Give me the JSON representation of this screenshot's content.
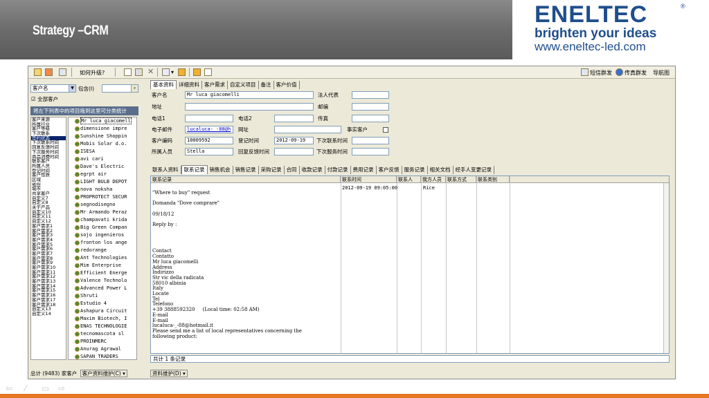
{
  "slide": {
    "title": "Strategy –CRM",
    "logo": {
      "name": "ENELTEC",
      "reg": "®",
      "tagline": "brighten your ideas",
      "url": "www.eneltec-led.com"
    }
  },
  "toolbar": {
    "upgrade_label": "如何升级?",
    "sms_label": "短信群发",
    "fax_label": "传真群发",
    "nav_label": "导航图"
  },
  "left": {
    "combo_value": "客户名",
    "include_label": "包含(I)",
    "search_value": "",
    "all_customers_label": "全部客户",
    "category_header": "将左下列表中的项目拖到这里可分类统计",
    "fields": [
      "客户来源",
      "所属行业",
      "客户等级",
      "下次联系",
      "签约状态",
      "下次联系时间",
      "回复反馈时间",
      "下次服务时间",
      "商品消费时间",
      "联系客户",
      "所属人员",
      "登记时间",
      "客户性质",
      "区域",
      "省份",
      "城市",
      "共享客户",
      "自定义7",
      "自定义8",
      "关于产品",
      "自定义10",
      "自定义11",
      "自定义12",
      "客户需求1",
      "客户需求2",
      "客户需求3",
      "客户需求4",
      "客户需求5",
      "客户需求6",
      "客户需求7",
      "客户需求8",
      "客户需求9",
      "客户需求10",
      "客户需求11",
      "客户需求12",
      "客户需求13",
      "客户需求14",
      "客户需求15",
      "客户需求16",
      "客户需求17",
      "客户需求18",
      "自定义13",
      "自定义14"
    ],
    "selected_field_index": 4,
    "customers": [
      "Mr luca giacomell",
      "dimensione impre",
      "Sunshine Shoppin",
      "Mobis Solar d.o.",
      "ISESA",
      "avi cari",
      "Dave's Electric",
      "egrpt air",
      "LIGHT BULB DEPOT",
      "nova noksha",
      "PROPROTECT SECUR",
      "segnodisegno",
      "Mr Armando Peraz",
      "champavati krida",
      "Big Green Compan",
      "sojo ingenieros",
      "fronton los ange",
      "redorange",
      "Ant Technologies",
      "Mim Enterprise",
      "Efficient Energe",
      "Valence Technolo",
      "Advanced Power L",
      "Shruti",
      "Estudio 4",
      "Ashapura Circuit",
      "Maxim Biotech, I",
      "ENAS TECHNOLOGIE",
      "tecnomascota sl",
      "PROINMERC",
      "Anurag Agrawal",
      "SAPAN TRADERS"
    ],
    "status_total": "总计 (9483) 家客户",
    "maintain_label": "客户资料维护(C)"
  },
  "right": {
    "top_tabs": [
      "基本资料",
      "详细资料",
      "客户需求",
      "自定义项目",
      "备注",
      "客户价值"
    ],
    "fields": {
      "customer_name_label": "客户名",
      "customer_name": "Mr luca giacomelli",
      "legal_rep_label": "法人代表",
      "legal_rep": "",
      "address_label": "地址",
      "address": "",
      "postcode_label": "邮编",
      "postcode": "",
      "phone1_label": "电话1",
      "phone1": "",
      "phone2_label": "电话2",
      "phone2": "",
      "fax_label": "传真",
      "fax": "",
      "email_label": "电子邮件",
      "email": "lucaluca-_-88@h",
      "website_label": "网址",
      "website": "",
      "real_customer_label": "事实客户",
      "code_label": "客户编码",
      "code": "10009592",
      "reg_time_label": "登记时间",
      "reg_time": "2012-09-19",
      "next_contact_label": "下次联系时间",
      "next_contact": "",
      "owner_label": "所属人员",
      "owner": "Stella",
      "reply_time_label": "回复反馈时间",
      "reply_time": "",
      "next_service_label": "下次服务时间",
      "next_service": ""
    },
    "record_tabs": [
      "联系人资料",
      "联系记录",
      "销售机会",
      "销售记录",
      "采购记录",
      "合同",
      "收款记录",
      "付款记录",
      "费用记录",
      "客户反馈",
      "服务记录",
      "相关文档",
      "经手人变更记录"
    ],
    "record_columns": [
      "联系记录",
      "联系时间",
      "联系人",
      "我方人员",
      "联系方式",
      "联系类别"
    ],
    "record": {
      "time": "2012-09-19 09:05:00",
      "staff": "Rice",
      "text": "\n\"Where to buy\" request\n\nDomanda \"Dove comprare\"\n\n09/18/12\n\nReply by :\n\n\n\n\nContact\nContatto\nMr luca giacomelli\nAddress\nIndirizzo\nStr vic della radicata\n58010 albinia\nItaly\nLocate\nTel\nTelefono\n+39 3888592320     (Local time: 02:58 AM)\nE-mail\nE-mail\nlucaluca-_-88@hotmail.it\nPlease send me a list of local representatives concerning the\nfollowing product:"
    },
    "record_count": "共计 1 条记录",
    "maintain_label": "资料维护(D)"
  }
}
